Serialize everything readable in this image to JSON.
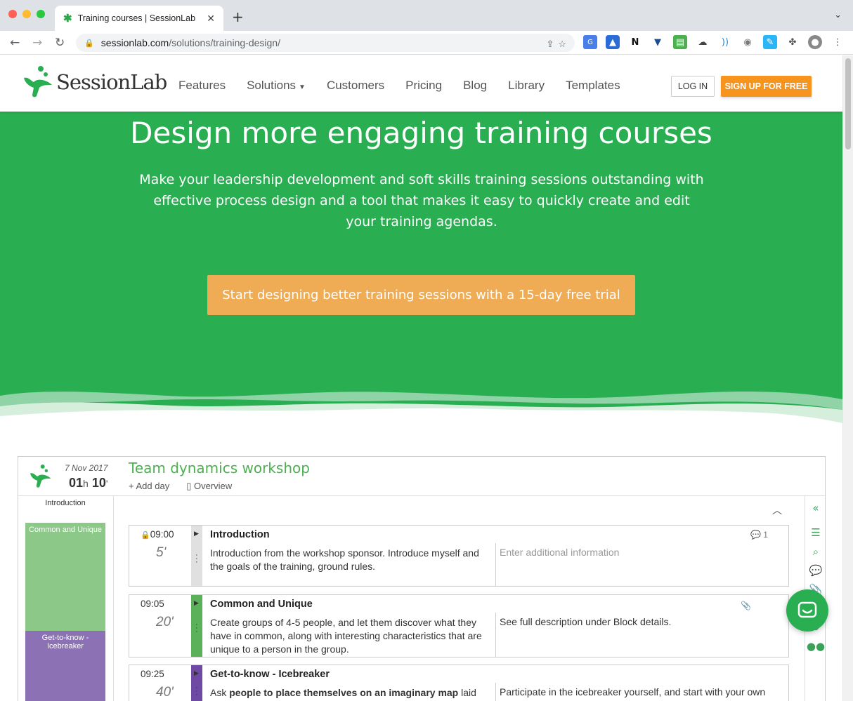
{
  "browser": {
    "tab_title": "Training courses | SessionLab",
    "tab_close": "✕",
    "new_tab": "+",
    "url_host": "sessionlab.com",
    "url_path": "/solutions/training-design/"
  },
  "site": {
    "logo": "SessionLab",
    "nav": [
      "Features",
      "Solutions",
      "Customers",
      "Pricing",
      "Blog",
      "Library",
      "Templates"
    ],
    "login": "LOG IN",
    "signup": "SIGN UP FOR FREE"
  },
  "hero": {
    "title": "Design more engaging training courses",
    "subtitle": "Make your leadership development and soft skills training sessions outstanding with effective process design and a tool that makes it easy to quickly create and edit your training agendas.",
    "cta": "Start designing better training sessions with a 15-day free trial"
  },
  "app": {
    "date": "7 Nov 2017",
    "duration_h": "01",
    "duration_h_unit": "h",
    "duration_m": "10",
    "duration_m_unit": "'",
    "title": "Team dynamics workshop",
    "add_day": "+ Add day",
    "overview": "Overview",
    "timeline": [
      {
        "label": "Introduction",
        "color": "#ffffff",
        "text_color": "#333333"
      },
      {
        "label": "Common and Unique",
        "color": "#8cc888",
        "text_color": "#ffffff"
      },
      {
        "label": "Get-to-know - Icebreaker",
        "color": "#8c72b4",
        "text_color": "#ffffff"
      }
    ],
    "blocks": [
      {
        "time": "09:00",
        "duration": "5'",
        "name": "Introduction",
        "desc": "Introduction from the workshop sponsor. Introduce myself and the goals of the training, ground rules.",
        "extra": "Enter additional information",
        "comments": "1",
        "bar_color": "#e0e0e0"
      },
      {
        "time": "09:05",
        "duration": "20'",
        "name": "Common and Unique",
        "desc": "Create groups of 4-5 people, and let them discover what they have in common, along with interesting characteristics that are unique to a person in the group.",
        "extra": "See full description under Block details.",
        "bar_color": "#5bb15a"
      },
      {
        "time": "09:25",
        "duration": "40'",
        "name": "Get-to-know - Icebreaker",
        "desc_prefix": "Ask ",
        "desc_bold": "people to place themselves on an imaginary map",
        "desc_suffix": " laid",
        "extra": "Participate in the icebreaker yourself, and start with your own",
        "bar_color": "#6f4aa5"
      }
    ]
  },
  "colors": {
    "brand_green": "#2aae52",
    "cta_orange": "#efac54",
    "signup_orange": "#f7941d"
  }
}
